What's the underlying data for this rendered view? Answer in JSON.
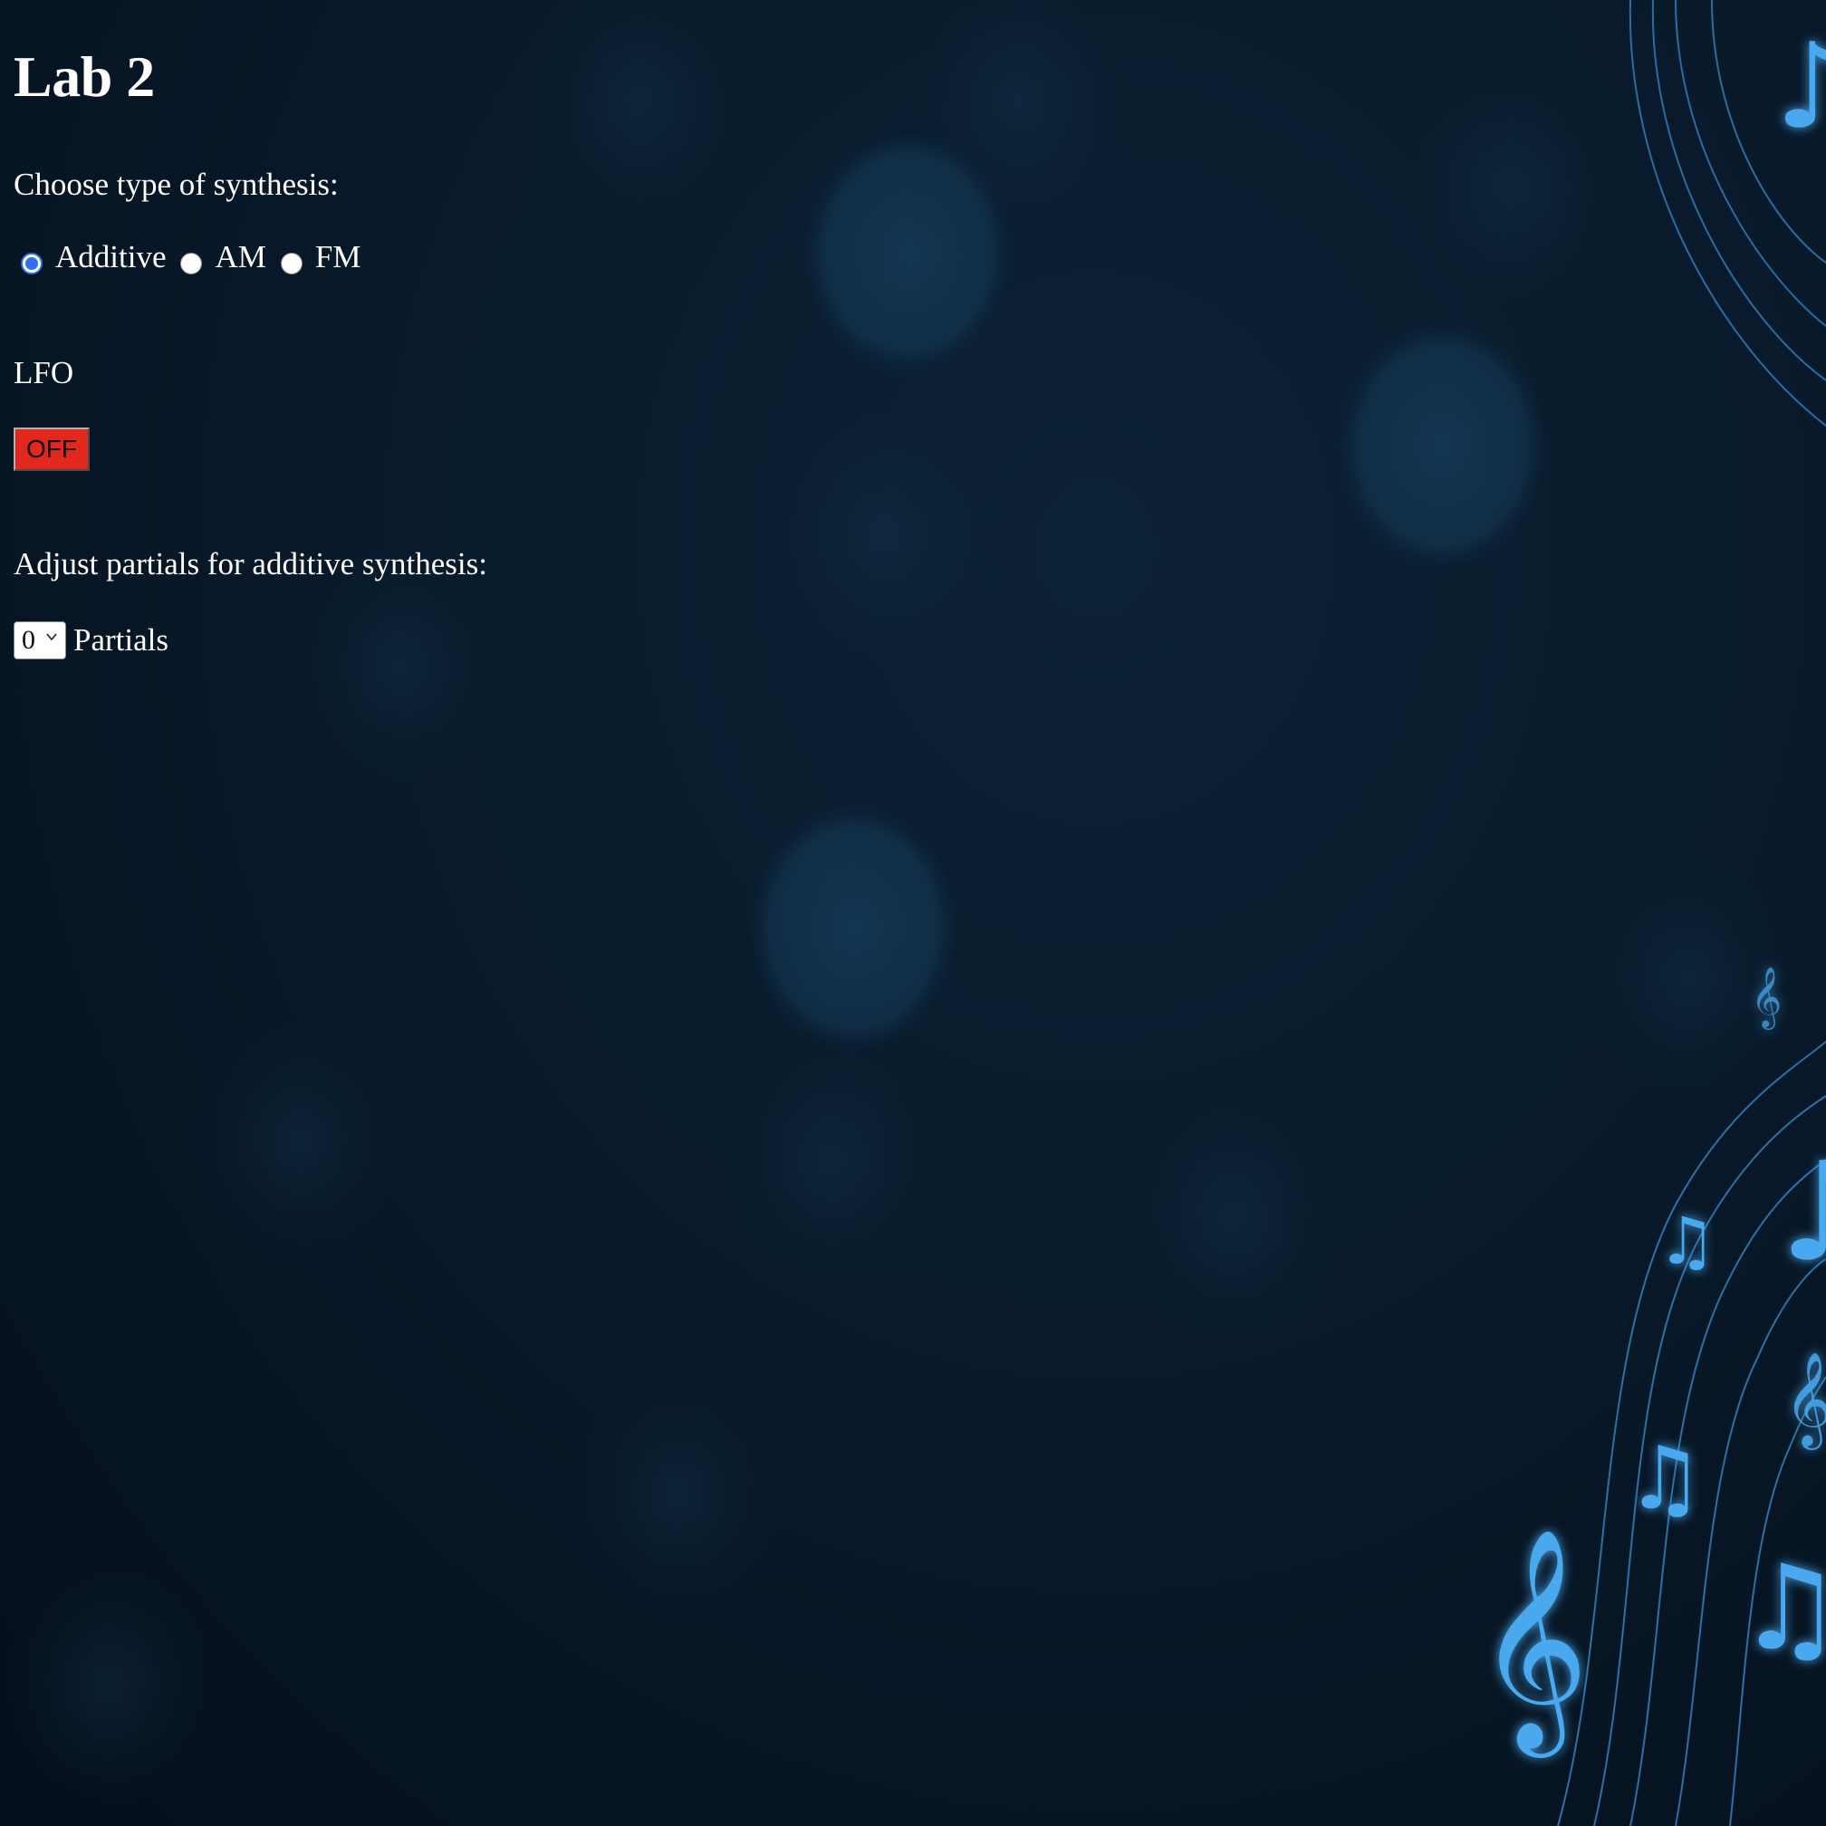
{
  "page": {
    "title": "Lab 2",
    "background_color": "#081a2b"
  },
  "synthesis": {
    "prompt": "Choose type of synthesis:",
    "options": [
      {
        "label": "Additive",
        "checked": true
      },
      {
        "label": "AM",
        "checked": false
      },
      {
        "label": "FM",
        "checked": false
      }
    ]
  },
  "lfo": {
    "label": "LFO",
    "button_label": "OFF",
    "button_color": "#e2271c"
  },
  "partials": {
    "prompt": "Adjust partials for additive synthesis:",
    "selected_value": "0",
    "label": "Partials"
  },
  "decor": {
    "note_color": "#4aa8ee",
    "icons": [
      "treble-clef-icon",
      "beamed-notes-icon",
      "eighth-note-icon"
    ]
  }
}
